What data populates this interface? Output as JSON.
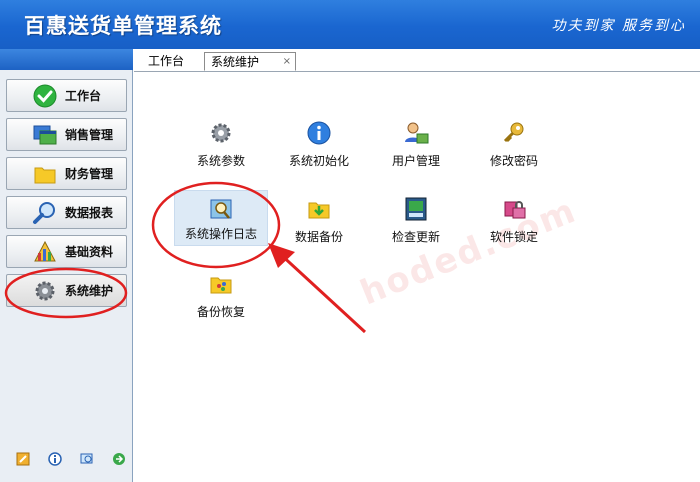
{
  "header": {
    "title": "百惠送货单管理系统",
    "slogan": "功夫到家 服务到心"
  },
  "tabs": [
    {
      "label": "工作台",
      "active": false
    },
    {
      "label": "系统维护",
      "active": true,
      "close": "×"
    }
  ],
  "sidebar": {
    "items": [
      {
        "label": "工作台",
        "icon": "check-icon"
      },
      {
        "label": "销售管理",
        "icon": "windows-icon"
      },
      {
        "label": "财务管理",
        "icon": "folder-icon"
      },
      {
        "label": "数据报表",
        "icon": "magnifier-icon"
      },
      {
        "label": "基础资料",
        "icon": "chart-icon"
      },
      {
        "label": "系统维护",
        "icon": "gear-icon",
        "active": true
      }
    ],
    "footer_icons": [
      "edit-icon",
      "info-icon",
      "search-icon",
      "exit-icon"
    ]
  },
  "tiles": [
    {
      "label": "系统参数",
      "icon": "gear-icon"
    },
    {
      "label": "系统初始化",
      "icon": "info-icon"
    },
    {
      "label": "用户管理",
      "icon": "users-icon"
    },
    {
      "label": "修改密码",
      "icon": "key-icon"
    },
    {
      "label": "系统操作日志",
      "icon": "log-icon",
      "selected": true
    },
    {
      "label": "数据备份",
      "icon": "backup-folder-icon"
    },
    {
      "label": "检查更新",
      "icon": "update-icon"
    },
    {
      "label": "软件锁定",
      "icon": "lock-icon"
    },
    {
      "label": "备份恢复",
      "icon": "restore-icon"
    }
  ],
  "watermark": "hoded.com",
  "colors": {
    "header_blue": "#1a66d0",
    "annotation_red": "#e02020",
    "selected_tile": "#ddeaf6"
  }
}
